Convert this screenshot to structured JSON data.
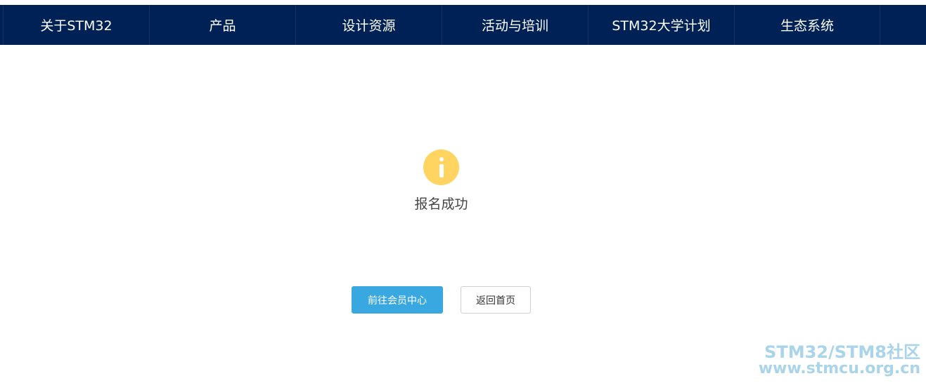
{
  "nav": {
    "items": [
      {
        "label": "关于STM32"
      },
      {
        "label": "产品"
      },
      {
        "label": "设计资源"
      },
      {
        "label": "活动与培训"
      },
      {
        "label": "STM32大学计划"
      },
      {
        "label": "生态系统"
      }
    ]
  },
  "status": {
    "icon": "info-icon",
    "message": "报名成功"
  },
  "actions": {
    "member_center_label": "前往会员中心",
    "home_label": "返回首页"
  },
  "watermark": {
    "line1": "STM32/STM8社区",
    "line2": "www.stmcu.org.cn"
  },
  "colors": {
    "nav_bg": "#002155",
    "icon_yellow": "#ffd461",
    "primary_button": "#3aa8e0",
    "watermark": "#a9d4ea"
  }
}
